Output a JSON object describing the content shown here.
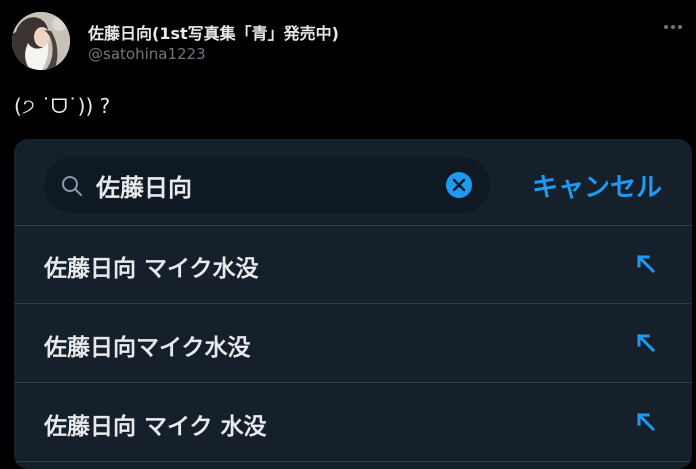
{
  "header": {
    "author_name": "佐藤日向(1st写真集「青」発売中)",
    "handle": "@satohina1223",
    "more_icon": "more-horizontal-icon"
  },
  "tweet": {
    "text": "(੭ ˙ᗜ˙)) ?"
  },
  "search": {
    "query": "佐藤日向",
    "search_icon": "search-icon",
    "clear_icon": "clear-icon",
    "cancel_label": "キャンセル"
  },
  "suggestions": [
    {
      "label": "佐藤日向 マイク水没",
      "icon": "fill-query-arrow-icon"
    },
    {
      "label": "佐藤日向マイク水没",
      "icon": "fill-query-arrow-icon"
    },
    {
      "label": "佐藤日向 マイク 水没",
      "icon": "fill-query-arrow-icon"
    }
  ],
  "colors": {
    "background": "#000000",
    "panel": "#15202b",
    "search_box": "#0f1923",
    "accent": "#1d9bf0",
    "primary_text": "#e7e9ea",
    "secondary_text": "#71767b"
  }
}
